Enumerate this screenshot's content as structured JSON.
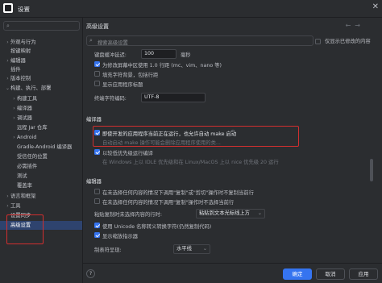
{
  "window": {
    "title": "设置",
    "close_glyph": "✕"
  },
  "sidebar": {
    "search_icon": "search-icon",
    "items": [
      {
        "label": "外观与行为",
        "chevron": "›"
      },
      {
        "label": "按键映射",
        "chevron": ""
      },
      {
        "label": "编辑器",
        "chevron": "›"
      },
      {
        "label": "插件",
        "chevron": ""
      },
      {
        "label": "版本控制",
        "chevron": "›"
      },
      {
        "label": "构建、执行、部署",
        "chevron": "⌄"
      },
      {
        "label": "构建工具",
        "chevron": "›"
      },
      {
        "label": "编译器",
        "chevron": "›"
      },
      {
        "label": "调试器",
        "chevron": "›"
      },
      {
        "label": "远程 Jar 仓库",
        "chevron": ""
      },
      {
        "label": "Android",
        "chevron": "›"
      },
      {
        "label": "Gradle-Android 编译器",
        "chevron": ""
      },
      {
        "label": "受信任的位置",
        "chevron": ""
      },
      {
        "label": "必需插件",
        "chevron": ""
      },
      {
        "label": "测试",
        "chevron": ""
      },
      {
        "label": "覆盖率",
        "chevron": ""
      },
      {
        "label": "语言和框架",
        "chevron": "›"
      },
      {
        "label": "工具",
        "chevron": "›"
      },
      {
        "label": "设置同步",
        "chevron": ""
      },
      {
        "label": "高级设置",
        "chevron": ""
      }
    ]
  },
  "main": {
    "title": "高级设置",
    "search_placeholder": "搜索高级设置",
    "only_modified_label": "仅显示已修改的内容",
    "reset_glyph": "↶",
    "nav_back": "←",
    "nav_forward": "→",
    "general": {
      "keyboard_delay_label": "键盘缓冲延迟:",
      "keyboard_delay_value": "100",
      "keyboard_delay_unit": "毫秒",
      "vim_cursor_label": "为修改屏幕中区使用 1.0 行距 (mc、vim、nano 等)",
      "vim_cursor_checked": true,
      "fill_char_label": "填充字符背景，包括行距",
      "fill_char_checked": false,
      "show_title_label": "显示应用程序标题",
      "show_title_checked": false,
      "encoding_label": "终端字符编码:",
      "encoding_value": "UTF-8"
    },
    "compiler_section": "编译器",
    "compiler": {
      "auto_make_label": "即使开发的应用程序当前正在运行，也允许自动 make 启动",
      "auto_make_checked": true,
      "auto_make_hint": "自动启动 make 操作可能会删除应用程序使用的类...",
      "low_priority_label": "以较低优先级运行编译",
      "low_priority_checked": true,
      "low_priority_hint": "在 Windows 上以 IDLE 优先级和在 Linux/MacOS 上以 nice 优先级 20 运行"
    },
    "editor_section": "编辑器",
    "editor": {
      "opt1_label": "在未选择任何内容的情况下调用\"复制\"或\"剪切\"操作时不复制当前行",
      "opt1_checked": false,
      "opt2_label": "在未选择任何内容的情况下调用\"复制\"操作时不选择当前行",
      "opt2_checked": false,
      "paste_label": "粘贴复制时未选择内容的行时:",
      "paste_value": "粘贴到文本光标线上方",
      "unicode_label": "使用 Unicode 名称转义转换字符(仍然复制代码)",
      "unicode_checked": true,
      "brace_label": "显示缩放指示器",
      "brace_checked": true,
      "tab_label": "制表符呈现:",
      "tab_value": "水平线"
    }
  },
  "footer": {
    "help": "?",
    "ok": "确定",
    "cancel": "取消",
    "apply": "应用"
  }
}
